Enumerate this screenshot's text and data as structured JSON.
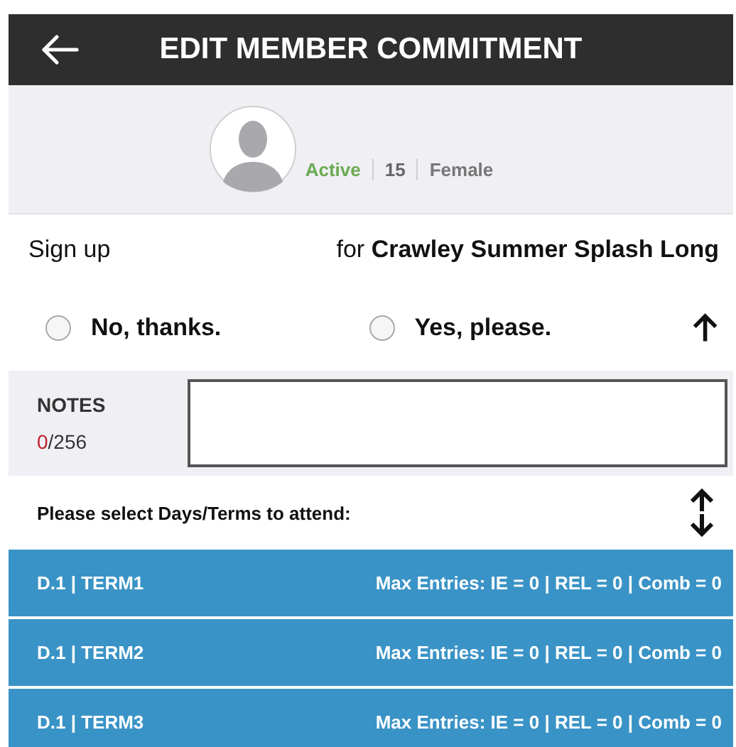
{
  "header": {
    "title": "EDIT MEMBER COMMITMENT"
  },
  "member": {
    "status": [
      {
        "text": "Active",
        "color": "#6aaa50"
      },
      {
        "text": "15",
        "color": "#666666"
      },
      {
        "text": "Female",
        "color": "#777777"
      }
    ]
  },
  "signup": {
    "label": "Sign up",
    "event": "for **Crawley Summer Splash Long**"
  },
  "options": [
    {
      "label": "No, thanks.",
      "selected": false
    },
    {
      "label": "Yes, please.",
      "selected": false
    }
  ],
  "notes": {
    "label": "NOTES",
    "count": "0",
    "limit": "/256"
  },
  "terms_prompt": "Please select Days/Terms to attend:",
  "terms": [
    {
      "name": "D.1 | TERM1",
      "limits": "Max Entries: IE = 0 | REL = 0 | Comb = 0"
    },
    {
      "name": "D.1 | TERM2",
      "limits": "Max Entries: IE = 0 | REL = 0 | Comb = 0"
    },
    {
      "name": "D.1 | TERM3",
      "limits": "Max Entries: IE = 0 | REL = 0 | Comb = 0"
    }
  ]
}
